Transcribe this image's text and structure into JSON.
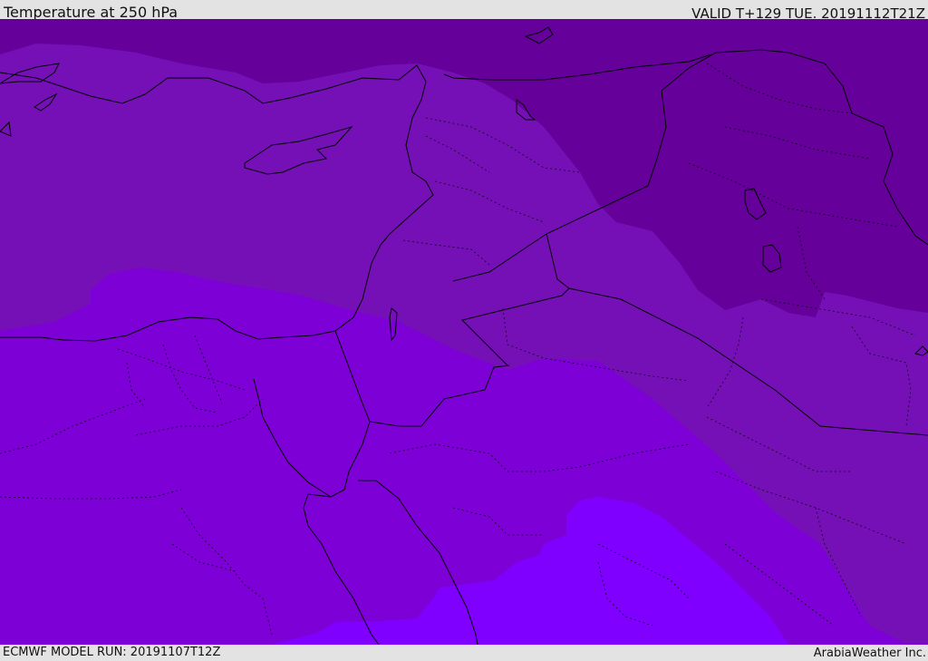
{
  "header": {
    "title": "Temperature at 250 hPa",
    "valid": "VALID T+129 TUE. 20191112T21Z"
  },
  "footer": {
    "model_run": "ECMWF MODEL RUN: 20191107T12Z",
    "credit": "ArabiaWeather Inc."
  },
  "map": {
    "field": "temperature",
    "level": "250 hPa",
    "bands": [
      {
        "name": "coldest",
        "color": "#65009a"
      },
      {
        "name": "cold",
        "color": "#7510b6"
      },
      {
        "name": "mild",
        "color": "#7d00d6"
      },
      {
        "name": "warmest",
        "color": "#8000ff"
      }
    ],
    "boundary_color": "#000000"
  }
}
